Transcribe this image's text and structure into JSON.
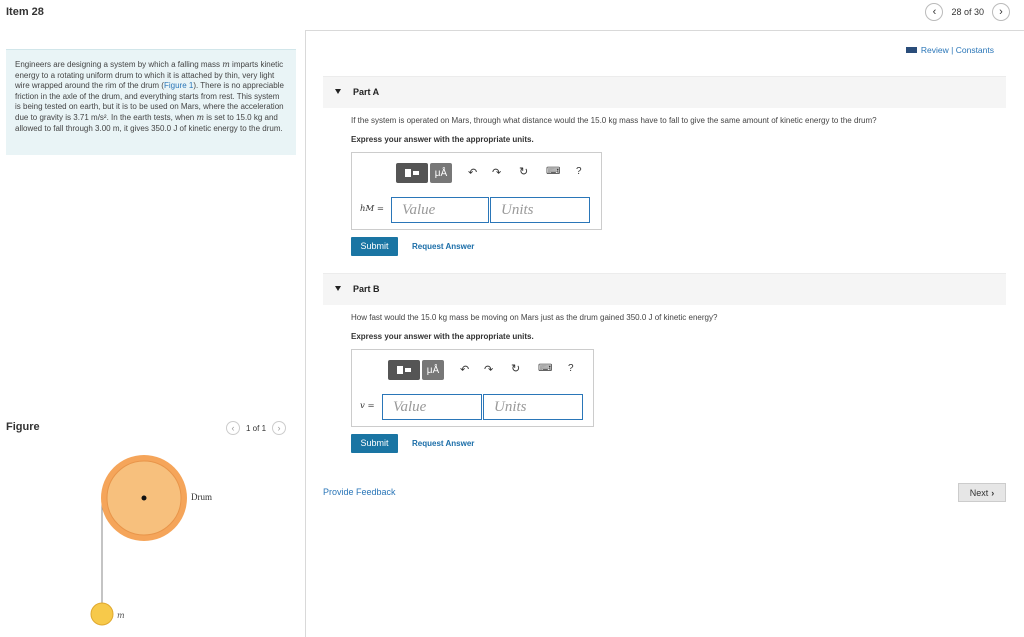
{
  "header": {
    "item_title": "Item 28",
    "pager_text": "28 of 30"
  },
  "problem": {
    "text_1": "Engineers are designing a system by which a falling mass ",
    "m1": "m",
    "text_2": " imparts kinetic energy to a rotating uniform drum to which it is attached by thin, very light wire wrapped around the rim of the drum (",
    "figure_link": "Figure 1",
    "text_3": "). There is no appreciable friction in the axle of the drum, and everything starts from rest. This system is being tested on earth, but it is to be used on Mars, where the acceleration due to gravity is 3.71 ",
    "unit_accel": "m/s²",
    "text_4": ". In the earth tests, when ",
    "m2": "m",
    "text_5": " is set to 15.0 ",
    "unit_kg": "kg",
    "text_6": " and allowed to fall through 3.00 ",
    "unit_m": "m",
    "text_7": ", it gives 350.0 ",
    "unit_J": "J",
    "text_8": " of kinetic energy to the drum."
  },
  "figure": {
    "label": "Figure",
    "pager": "1 of 1",
    "drum_label": "Drum",
    "mass_label": "m"
  },
  "review": {
    "text": "Review | Constants"
  },
  "part_a": {
    "label": "Part A",
    "question": "If the system is operated on Mars, through what distance would the 15.0 kg mass have to fall to give the same amount of kinetic energy to the drum?",
    "express": "Express your answer with the appropriate units.",
    "var_label": "hM =",
    "value_placeholder": "Value",
    "units_placeholder": "Units",
    "submit": "Submit",
    "request": "Request Answer"
  },
  "part_b": {
    "label": "Part B",
    "question": "How fast would the 15.0 kg mass be moving on Mars just as the drum gained 350.0 J of kinetic energy?",
    "express": "Express your answer with the appropriate units.",
    "var_label": "v =",
    "value_placeholder": "Value",
    "units_placeholder": "Units",
    "submit": "Submit",
    "request": "Request Answer"
  },
  "toolbar": {
    "mu_label": "μÅ",
    "help": "?"
  },
  "footer": {
    "feedback": "Provide Feedback",
    "next": "Next"
  },
  "colors": {
    "accent": "#1a75a3",
    "link": "#2a76b8",
    "drum_outer": "#f5a55a",
    "drum_inner": "#f7c07d",
    "mass": "#f7c94a"
  }
}
